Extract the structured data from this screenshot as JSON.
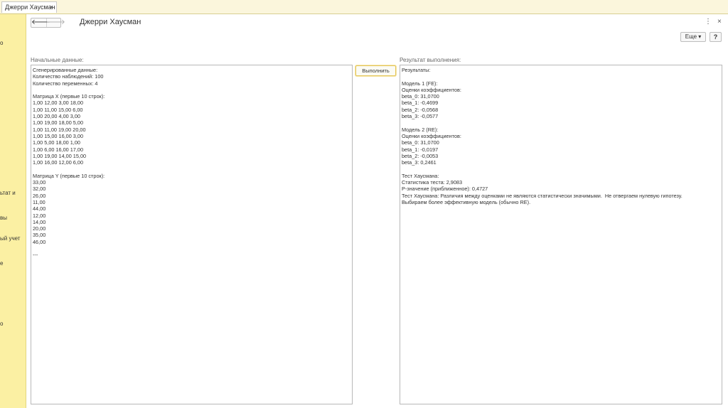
{
  "tab": {
    "label": "Джерри Хаусман",
    "close": "×"
  },
  "sidebar": {
    "items": [
      {
        "label": "о"
      },
      {
        "label": "ьтат и"
      },
      {
        "label": "вы"
      },
      {
        "label": "ый учет"
      },
      {
        "label": "е"
      },
      {
        "label": "о"
      }
    ]
  },
  "header": {
    "back": "🡐",
    "forward": "🡒",
    "title": "Джерри Хаусман",
    "more_menu": "⋮",
    "close": "×"
  },
  "toolbar": {
    "more_label": "Еще ▾",
    "help_label": "?"
  },
  "input_panel": {
    "caption": "Начальные данные:",
    "text": "Сгенерированные данные:\nКоличество наблюдений: 100\nКоличество переменных: 4\n\nМатрица X (первые 10 строк):\n1,00 12,00 3,00 18,00\n1,00 11,00 15,00 6,00\n1,00 20,00 4,00 3,00\n1,00 19,00 18,00 5,00\n1,00 11,00 19,00 20,00\n1,00 15,00 16,00 3,00\n1,00 5,00 18,00 1,00\n1,00 6,00 16,00 17,00\n1,00 19,00 14,00 15,00\n1,00 16,00 12,00 6,00\n\nМатрица Y (первые 10 строк):\n33,00\n32,00\n26,00\n11,00\n44,00\n12,00\n14,00\n20,00\n35,00\n46,00\n\n---"
  },
  "run_button": {
    "label": "Выполнить"
  },
  "output_panel": {
    "caption": "Результат выполнения:",
    "text": "Результаты:\n\nМодель 1 (FE):\nОценки коэффициентов:\nbeta_0: 31,0700\nbeta_1: -0,4699\nbeta_2: -0,0568\nbeta_3: -0,0577\n\nМодель 2 (RE):\nОценки коэффициентов:\nbeta_0: 31,0700\nbeta_1: -0,0197\nbeta_2: -0,0053\nbeta_3: 0,2461\n\nТест Хаусмана:\nСтатистика теста: 2,9083\nP-значение (приближенное): 0,4727\nТест Хаусмана: Различия между оценками не являются статистически значимыми.  Не отвергаем нулевую гипотезу.\nВыбираем более эффективную модель (обычно RE)."
  }
}
